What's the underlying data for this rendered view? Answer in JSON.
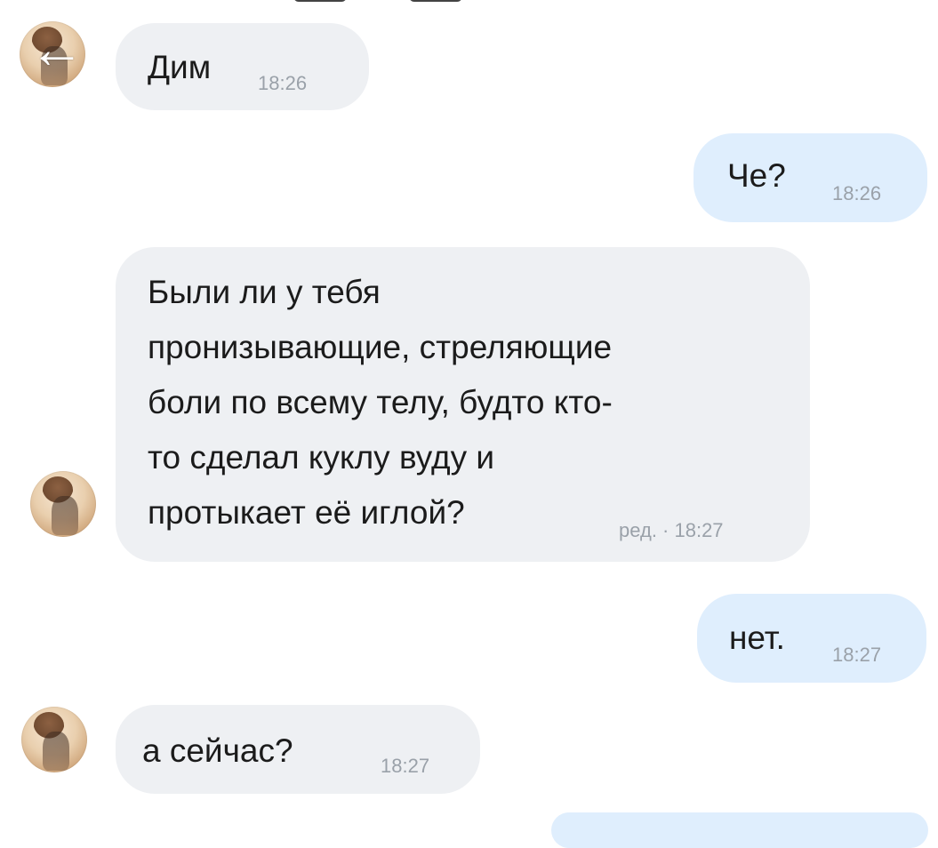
{
  "messages": [
    {
      "side": "incoming",
      "text": "Дим",
      "time": "18:26"
    },
    {
      "side": "outgoing",
      "text": "Че?",
      "time": "18:26"
    },
    {
      "side": "incoming",
      "lines": [
        "Были ли у тебя",
        "пронизывающие, стреляющие",
        "боли по всему телу, будто кто-",
        "то сделал куклу вуду и",
        "протыкает её иглой?"
      ],
      "time": "ред. · 18:27"
    },
    {
      "side": "outgoing",
      "text": "нет.",
      "time": "18:27"
    },
    {
      "side": "incoming",
      "text": "а сейчас?",
      "time": "18:27"
    }
  ],
  "icons": {
    "back": "←"
  },
  "colors": {
    "incoming_bubble": "#eef0f3",
    "outgoing_bubble": "#dfeefd",
    "time_text": "#9aa1a9"
  }
}
